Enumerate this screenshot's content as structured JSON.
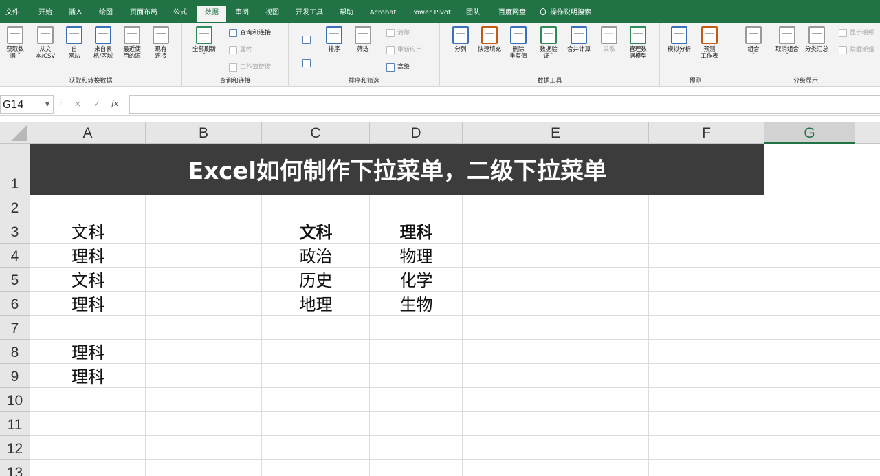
{
  "menu": {
    "tabs": [
      "文件",
      "开始",
      "插入",
      "绘图",
      "页面布局",
      "公式",
      "数据",
      "审阅",
      "视图",
      "开发工具",
      "帮助",
      "Acrobat",
      "Power Pivot",
      "团队",
      "百度网盘"
    ],
    "active_tab": "数据",
    "search": "操作说明搜索"
  },
  "ribbon": {
    "get_transform": {
      "label": "获取和转换数据",
      "buttons": [
        "获取数\n据 ˅",
        "从文\n本/CSV",
        "自\n网站",
        "来自表\n格/区域",
        "最近使\n用的源",
        "现有\n连接"
      ]
    },
    "queries": {
      "label": "查询和连接",
      "refresh_all": "全部刷新\n˅",
      "items": [
        "查询和连接",
        "属性",
        "工作簿链接"
      ]
    },
    "sort_filter": {
      "label": "排序和筛选",
      "sort": "排序",
      "filter": "筛选",
      "clear": "清除",
      "reapply": "重新应用",
      "advanced": "高级"
    },
    "data_tools": {
      "label": "数据工具",
      "buttons": [
        "分列",
        "快速填充",
        "删除\n重复值",
        "数据验\n证 ˅",
        "合并计算",
        "关系",
        "管理数\n据模型"
      ]
    },
    "forecast": {
      "label": "预测",
      "buttons": [
        "模拟分析\n˅",
        "预测\n工作表"
      ]
    },
    "outline": {
      "label": "分级显示",
      "buttons": [
        "组合\n˅",
        "取消组合\n˅",
        "分类汇总"
      ],
      "show_detail": "显示明细",
      "hide_detail": "隐藏明细"
    }
  },
  "formula_bar": {
    "name_box": "G14",
    "cancel": "×",
    "enter": "✓",
    "fx": "fx",
    "value": ""
  },
  "sheet": {
    "columns": [
      "A",
      "B",
      "C",
      "D",
      "E",
      "F",
      "G"
    ],
    "selected_column": "G",
    "rows": [
      "1",
      "2",
      "3",
      "4",
      "5",
      "6",
      "7",
      "8",
      "9",
      "10",
      "11",
      "12",
      "13"
    ],
    "title": "Excel如何制作下拉菜单，二级下拉菜单",
    "col_a": {
      "r3": "文科",
      "r4": "理科",
      "r5": "文科",
      "r6": "理科",
      "r8": "理科",
      "r9": "理科"
    },
    "col_c": {
      "r3": "文科",
      "r4": "政治",
      "r5": "历史",
      "r6": "地理"
    },
    "col_d": {
      "r3": "理科",
      "r4": "物理",
      "r5": "化学",
      "r6": "生物"
    }
  }
}
